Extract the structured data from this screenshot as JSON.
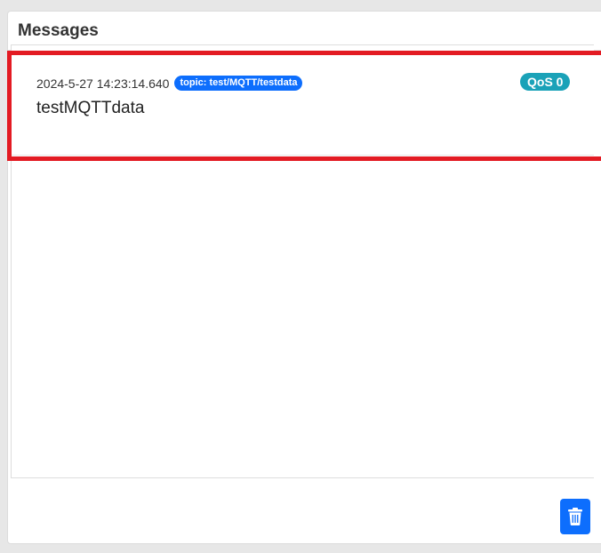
{
  "panel": {
    "title": "Messages"
  },
  "messages": [
    {
      "timestamp": "2024-5-27 14:23:14.640",
      "topic": "topic: test/MQTT/testdata",
      "qos": "QoS 0",
      "payload": "testMQTTdata"
    }
  ],
  "actions": {
    "clear_icon": "trash-icon"
  },
  "colors": {
    "topic_badge": "#0d6efd",
    "qos_badge": "#1aa2b8",
    "highlight_border": "#e31b23",
    "clear_button": "#0d6efd"
  }
}
